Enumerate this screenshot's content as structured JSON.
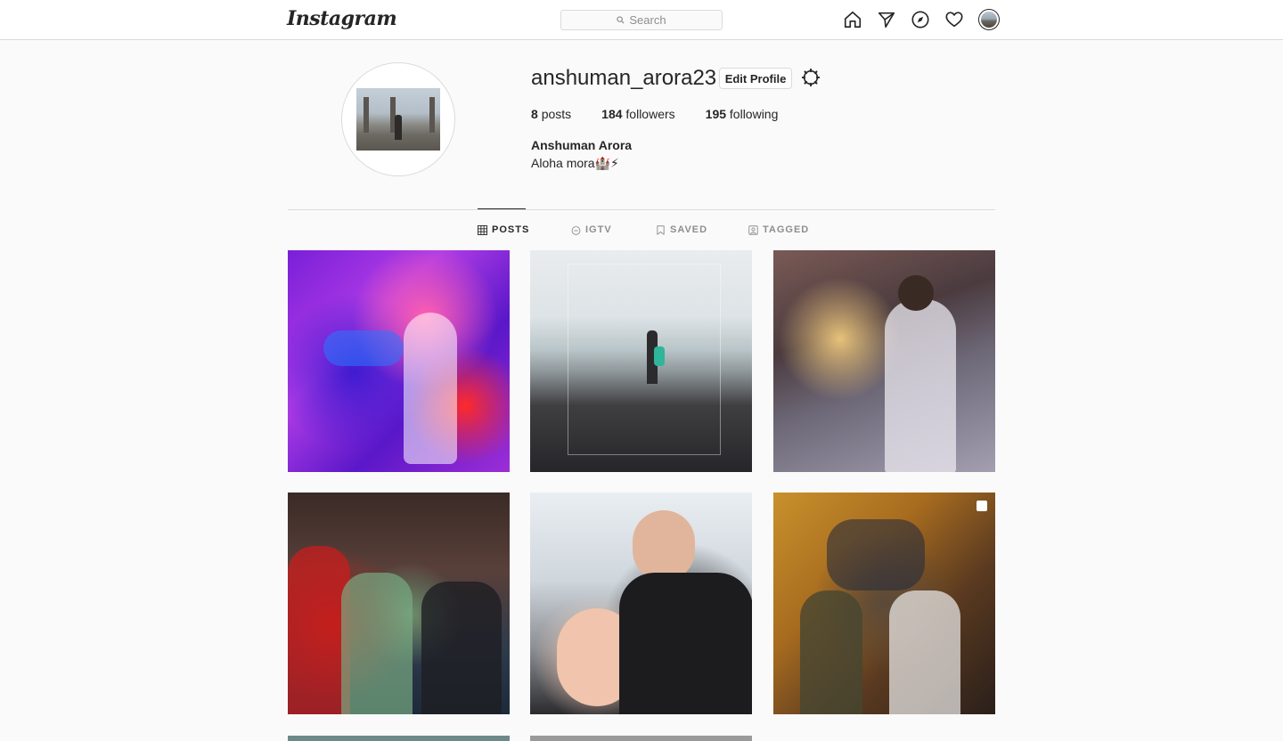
{
  "nav": {
    "logo": "Instagram",
    "search_placeholder": "Search",
    "icons": [
      "home-icon",
      "direct-icon",
      "explore-icon",
      "activity-icon",
      "profile-avatar"
    ]
  },
  "profile": {
    "username": "anshuman_arora23",
    "edit_label": "Edit Profile",
    "stats": {
      "posts_count": "8",
      "posts_label": "posts",
      "followers_count": "184",
      "followers_label": "followers",
      "following_count": "195",
      "following_label": "following"
    },
    "full_name": "Anshuman Arora",
    "bio": "Aloha mora🏰⚡"
  },
  "tabs": [
    {
      "label": "POSTS",
      "icon": "grid-icon",
      "active": true
    },
    {
      "label": "IGTV",
      "icon": "igtv-icon",
      "active": false
    },
    {
      "label": "SAVED",
      "icon": "bookmark-icon",
      "active": false
    },
    {
      "label": "TAGGED",
      "icon": "tag-icon",
      "active": false
    }
  ],
  "colors": {
    "background": "#fafafa",
    "border": "#dbdbdb",
    "text": "#262626",
    "muted": "#8e8e8e"
  }
}
